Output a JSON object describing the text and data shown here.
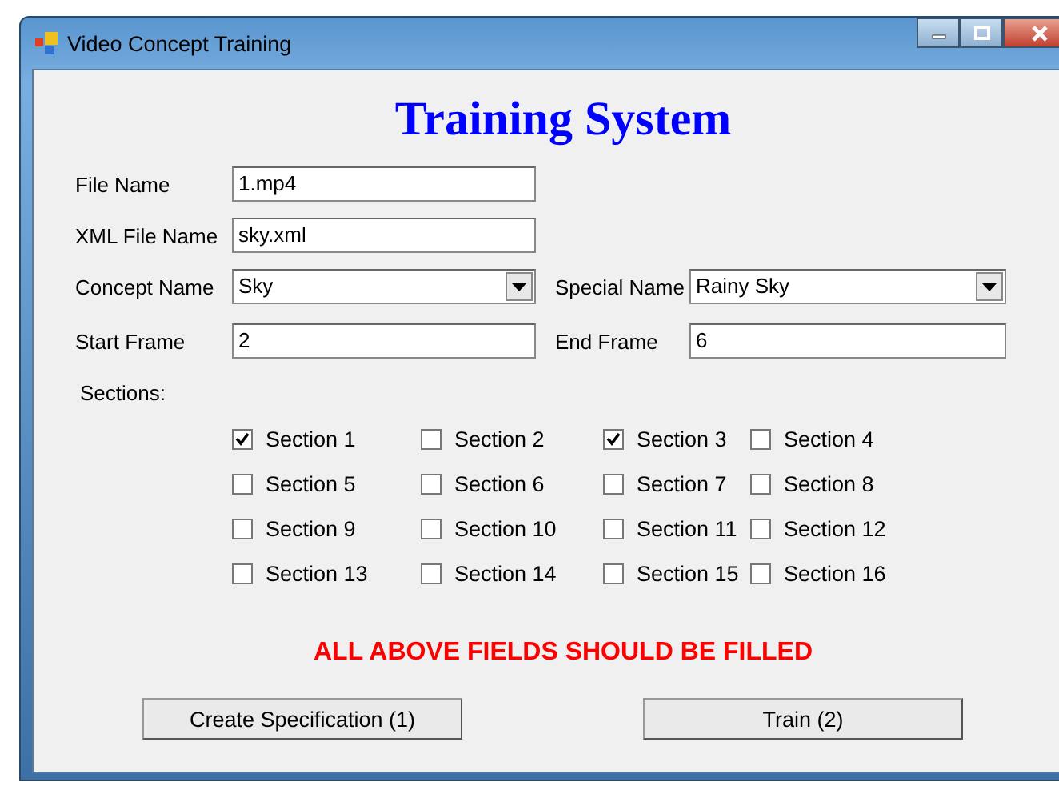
{
  "window": {
    "title": "Video Concept Training"
  },
  "heading": "Training System",
  "fields": [
    {
      "label": "File Name",
      "value": "1.mp4"
    },
    {
      "label": "XML File Name",
      "value": "sky.xml"
    }
  ],
  "pairs": [
    {
      "left": {
        "label": "Concept Name",
        "value": "Sky",
        "kind": "combo"
      },
      "right": {
        "label": "Special Name",
        "value": "Rainy Sky",
        "kind": "combo"
      }
    },
    {
      "left": {
        "label": "Start Frame",
        "value": "2",
        "kind": "text"
      },
      "right": {
        "label": "End Frame",
        "value": "6",
        "kind": "text"
      }
    }
  ],
  "sections_label": "Sections:",
  "sections": [
    {
      "label": "Section 1",
      "checked": true
    },
    {
      "label": "Section 2",
      "checked": false
    },
    {
      "label": "Section 3",
      "checked": true
    },
    {
      "label": "Section 4",
      "checked": false
    },
    {
      "label": "Section 5",
      "checked": false
    },
    {
      "label": "Section 6",
      "checked": false
    },
    {
      "label": "Section 7",
      "checked": false
    },
    {
      "label": "Section 8",
      "checked": false
    },
    {
      "label": "Section 9",
      "checked": false
    },
    {
      "label": "Section 10",
      "checked": false
    },
    {
      "label": "Section 11",
      "checked": false
    },
    {
      "label": "Section 12",
      "checked": false
    },
    {
      "label": "Section 13",
      "checked": false
    },
    {
      "label": "Section 14",
      "checked": false
    },
    {
      "label": "Section 15",
      "checked": false
    },
    {
      "label": "Section 16",
      "checked": false
    }
  ],
  "warning": "ALL ABOVE FIELDS SHOULD BE FILLED",
  "buttons": [
    "Create Specification (1)",
    "Train (2)"
  ]
}
